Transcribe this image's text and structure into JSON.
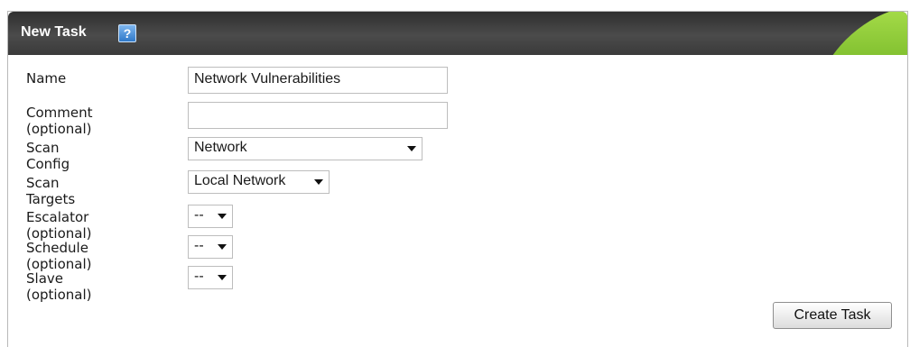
{
  "dialog": {
    "title": "New Task",
    "help_glyph": "?",
    "accent_color": "#8ccc36",
    "title_bar_color": "#3a3a3a"
  },
  "form": {
    "name": {
      "label": "Name",
      "value": "Network Vulnerabilities"
    },
    "comment": {
      "label": "Comment (optional)",
      "value": ""
    },
    "scan_config": {
      "label": "Scan Config",
      "selected": "Network"
    },
    "scan_targets": {
      "label": "Scan Targets",
      "selected": "Local Network"
    },
    "escalator": {
      "label": "Escalator (optional)",
      "selected": "--"
    },
    "schedule": {
      "label": "Schedule (optional)",
      "selected": "--"
    },
    "slave": {
      "label": "Slave (optional)",
      "selected": "--"
    }
  },
  "actions": {
    "create_label": "Create Task"
  }
}
